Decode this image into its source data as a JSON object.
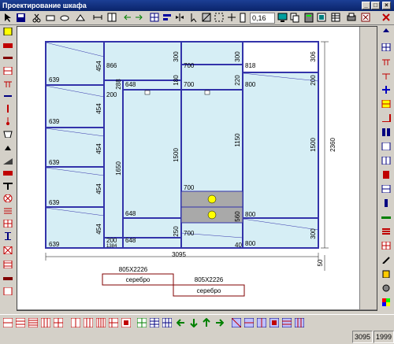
{
  "window": {
    "title": "Проектирование шкафа",
    "min": "_",
    "max": "□",
    "close": "×"
  },
  "toolbar": {
    "zoom_value": "0,16"
  },
  "cabinet": {
    "width_label": "3095",
    "height_label": "2360",
    "bottom_gap_label": "50",
    "sections": {
      "s1": [
        "639",
        "454",
        "639",
        "454",
        "639",
        "454",
        "639",
        "454",
        "639",
        "454"
      ],
      "s2": [
        "866",
        "200",
        "288",
        "1650",
        "200",
        "1384"
      ],
      "s3": [
        "300",
        "648",
        "180",
        "1500",
        "648",
        "250",
        "648"
      ],
      "s4": [
        "700",
        "300",
        "700",
        "220",
        "1150",
        "700",
        "560",
        "700",
        "40"
      ],
      "s5": [
        "818",
        "306",
        "800",
        "200",
        "1500",
        "800",
        "300",
        "800"
      ]
    }
  },
  "doors": [
    {
      "size": "805X2226",
      "material": "серебро"
    },
    {
      "size": "805X2226",
      "material": "серебро"
    }
  ],
  "status": {
    "left": "3095",
    "right": "1999"
  }
}
